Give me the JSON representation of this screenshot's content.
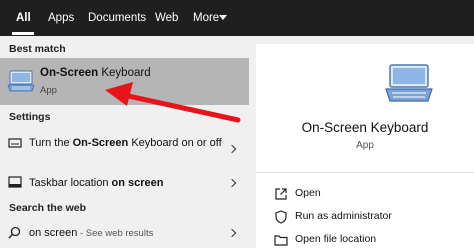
{
  "tabs": {
    "all": "All",
    "apps": "Apps",
    "documents": "Documents",
    "web": "Web",
    "more": "More"
  },
  "left": {
    "best_match_header": "Best match",
    "best_match": {
      "title_bold": "On-Screen",
      "title_rest": " Keyboard",
      "subtitle": "App"
    },
    "settings_header": "Settings",
    "settings_items": [
      {
        "pre": "Turn the ",
        "bold": "On-Screen",
        "post": " Keyboard on or off"
      },
      {
        "pre": "Taskbar location ",
        "bold": "on screen",
        "post": ""
      }
    ],
    "web_header": "Search the web",
    "web_item": {
      "query": "on screen",
      "suffix": " - See web results"
    }
  },
  "right": {
    "title": "On-Screen Keyboard",
    "subtitle": "App",
    "actions": [
      {
        "label": "Open",
        "icon": "open-icon"
      },
      {
        "label": "Run as administrator",
        "icon": "shield-icon"
      },
      {
        "label": "Open file location",
        "icon": "folder-icon"
      }
    ]
  },
  "colors": {
    "topbar": "#1f1f1f",
    "selected_row": "#b5b5b5",
    "annotation_arrow": "#e8141b"
  }
}
